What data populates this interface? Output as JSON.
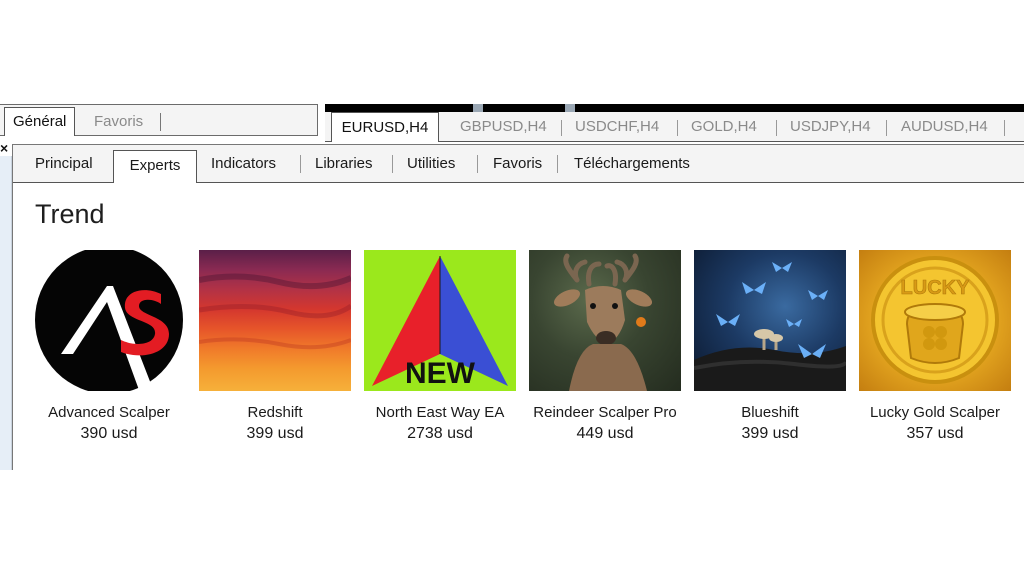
{
  "left_panel": {
    "tabs": [
      "Général",
      "Favoris"
    ]
  },
  "chart_tabs": {
    "active": "EURUSD,H4",
    "others": [
      "GBPUSD,H4",
      "USDCHF,H4",
      "GOLD,H4",
      "USDJPY,H4",
      "AUDUSD,H4"
    ]
  },
  "market": {
    "tabs": [
      "Principal",
      "Experts",
      "Indicators",
      "Libraries",
      "Utilities",
      "Favoris",
      "Téléchargements"
    ],
    "active_tab": "Experts",
    "section_title": "Trend",
    "products": [
      {
        "name": "Advanced Scalper",
        "price": "390 usd",
        "thumb_icon": "advanced-scalper-logo"
      },
      {
        "name": "Redshift",
        "price": "399 usd",
        "thumb_icon": "red-sunset-image"
      },
      {
        "name": "North East Way EA",
        "price": "2738 usd",
        "thumb_icon": "new-arrow-logo",
        "badge": "NEW"
      },
      {
        "name": "Reindeer Scalper Pro",
        "price": "449 usd",
        "thumb_icon": "reindeer-photo"
      },
      {
        "name": "Blueshift",
        "price": "399 usd",
        "thumb_icon": "blue-butterflies-image"
      },
      {
        "name": "Lucky Gold Scalper",
        "price": "357 usd",
        "thumb_icon": "lucky-gold-coin",
        "badge": "LUCKY"
      }
    ]
  },
  "close_glyph": "×"
}
